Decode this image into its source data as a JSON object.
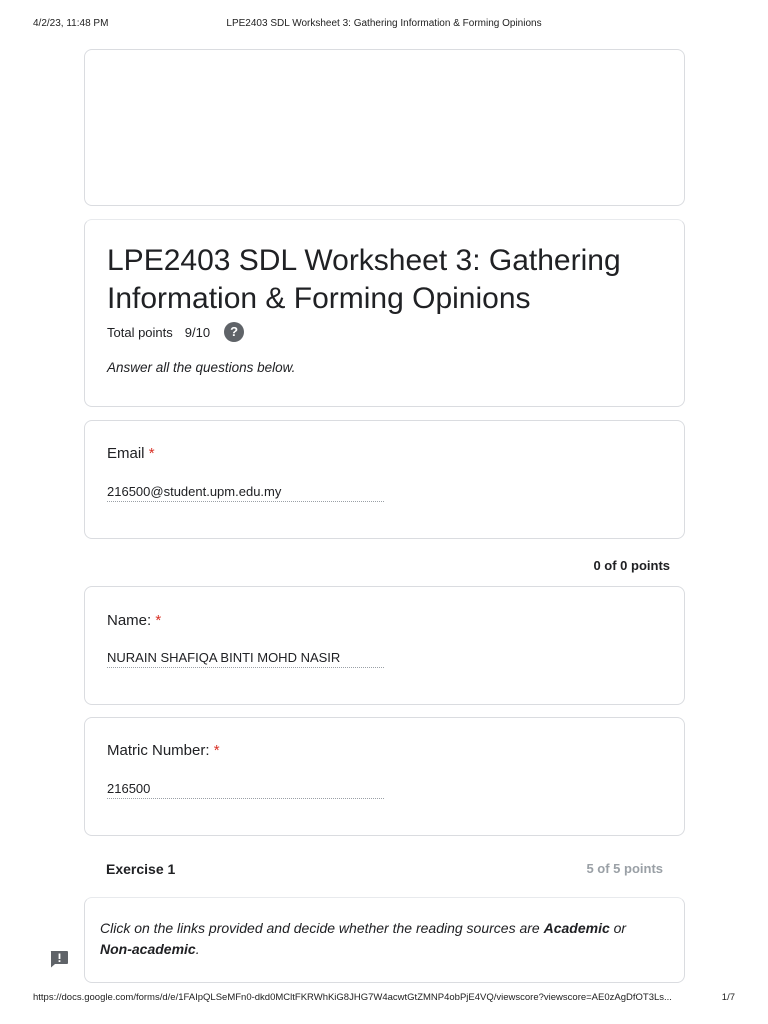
{
  "print_header": {
    "date": "4/2/23, 11:48 PM",
    "title": "LPE2403 SDL Worksheet 3: Gathering Information & Forming Opinions"
  },
  "form": {
    "title": "LPE2403 SDL Worksheet 3:  Gathering Information & Forming Opinions",
    "total_points_label": "Total points",
    "total_points_value": "9/10",
    "help_icon_glyph": "?",
    "description": "Answer all the questions below."
  },
  "email_question": {
    "label": "Email",
    "required_mark": "*",
    "answer": "216500@student.upm.edu.my"
  },
  "section_points": "0 of 0 points",
  "name_question": {
    "label": "Name:",
    "required_mark": "*",
    "answer": "NURAIN SHAFIQA BINTI MOHD NASIR"
  },
  "matric_question": {
    "label": "Matric Number:",
    "required_mark": "*",
    "answer": "216500"
  },
  "exercise": {
    "title": "Exercise 1",
    "points": "5 of 5 points",
    "instruction_part1": "Click on the links provided and decide whether the reading sources are ",
    "instruction_bold1": "Academic",
    "instruction_part2": " or ",
    "instruction_bold2": "Non-academic",
    "instruction_part3": "."
  },
  "icons": {
    "help": "help-circle-icon",
    "feedback": "feedback-icon"
  },
  "print_footer": {
    "url": "https://docs.google.com/forms/d/e/1FAIpQLSeMFn0-dkd0MCltFKRWhKiG8JHG7W4acwtGtZMNP4obPjE4VQ/viewscore?viewscore=AE0zAgDfOT3Ls...",
    "page": "1/7"
  }
}
